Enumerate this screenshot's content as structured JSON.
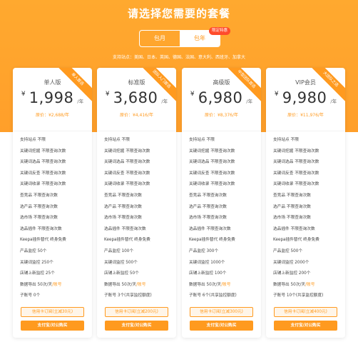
{
  "page": {
    "title": "请选择您需要的套餐",
    "toggle": {
      "month": "包月",
      "year": "包年",
      "badge": "限定特惠"
    },
    "sites_line": "支持站点：美国、日本、英国、德国、法国、意大利、西班牙、加拿大"
  },
  "colors": {
    "accent": "#ff9a1f",
    "hero": "#ffa92f",
    "hot_badge": "#ff4b2b"
  },
  "plans": [
    {
      "name": "单人版",
      "ribbon": "单人首选",
      "currency": "¥",
      "price": "1,998",
      "unit": "/年",
      "original": "原价：¥2,688/年",
      "features": [
        "支持站点 不限",
        "关键词挖掘 不限查询次数",
        "关键词选品 不限查询次数",
        "关键词反查 不限查询次数",
        "关键词收录 不限查询次数",
        "查竞品 不限查询次数",
        "选产品 不限查询次数",
        "选市场 不限查询次数",
        "选品插件 不限查询次数",
        "Keepa插件替代 终身免费",
        "产品监控 50个",
        "关键词监控 250个",
        "店铺上新监控 25个",
        "数据导出 50次/天/账号",
        "子账号 0个"
      ],
      "card_btn": "信用卡订阅(立减30元)",
      "buy_btn": "支付宝/对公购买"
    },
    {
      "name": "标准版",
      "ribbon": "团队入门首选",
      "currency": "¥",
      "price": "3,680",
      "unit": "/年",
      "original": "原价：¥4,416/年",
      "features": [
        "支持站点 不限",
        "关键词挖掘 不限查询次数",
        "关键词选品 不限查询次数",
        "关键词反查 不限查询次数",
        "关键词收录 不限查询次数",
        "查竞品 不限查询次数",
        "选产品 不限查询次数",
        "选市场 不限查询次数",
        "选品插件 不限查询次数",
        "Keepa插件替代 终身免费",
        "产品监控 100个",
        "关键词监控 500个",
        "店铺上新监控 50个",
        "数据导出 50次/天/账号",
        "子账号 3个(共享监控额度)"
      ],
      "card_btn": "信用卡订阅(立减200元)",
      "buy_btn": "支付宝/对公购买"
    },
    {
      "name": "高级版",
      "ribbon": "中型团队首选",
      "currency": "¥",
      "price": "6,980",
      "unit": "/年",
      "original": "原价：¥8,376/年",
      "features": [
        "支持站点 不限",
        "关键词挖掘 不限查询次数",
        "关键词选品 不限查询次数",
        "关键词反查 不限查询次数",
        "关键词收录 不限查询次数",
        "查竞品 不限查询次数",
        "选产品 不限查询次数",
        "选市场 不限查询次数",
        "选品插件 不限查询次数",
        "Keepa插件替代 终身免费",
        "产品监控 300个",
        "关键词监控 1000个",
        "店铺上新监控 100个",
        "数据导出 50次/天/账号",
        "子账号 6个(共享监控额度)"
      ],
      "card_btn": "信用卡订阅(立减300元)",
      "buy_btn": "支付宝/对公购买"
    },
    {
      "name": "VIP会员",
      "ribbon": "大团队之选",
      "currency": "¥",
      "price": "9,980",
      "unit": "/年",
      "original": "原价：¥11,976/年",
      "features": [
        "支持站点 不限",
        "关键词挖掘 不限查询次数",
        "关键词选品 不限查询次数",
        "关键词反查 不限查询次数",
        "关键词收录 不限查询次数",
        "查竞品 不限查询次数",
        "选产品 不限查询次数",
        "选市场 不限查询次数",
        "选品插件 不限查询次数",
        "Keepa插件替代 终身免费",
        "产品监控 500个",
        "关键词监控 2000个",
        "店铺上新监控 200个",
        "数据导出 50次/天/账号",
        "子账号 10个(共享监控额度)"
      ],
      "card_btn": "信用卡订阅(立减400元)",
      "buy_btn": "支付宝/对公购买"
    }
  ]
}
